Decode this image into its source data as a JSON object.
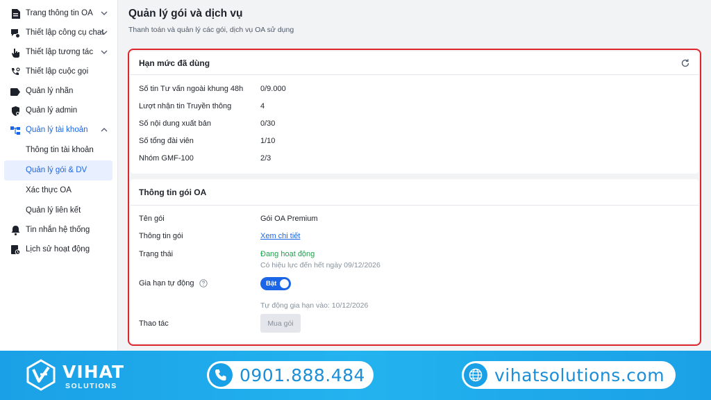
{
  "sidebar": {
    "items": [
      {
        "label": "Trang thông tin OA",
        "icon": "document-icon",
        "chevron": "down"
      },
      {
        "label": "Thiết lập công cụ chat",
        "icon": "chat-settings-icon",
        "chevron": "down"
      },
      {
        "label": "Thiết lập tương tác",
        "icon": "pointer-hand-icon",
        "chevron": "down"
      },
      {
        "label": "Thiết lập cuộc gọi",
        "icon": "phone-settings-icon"
      },
      {
        "label": "Quản lý nhãn",
        "icon": "tag-icon"
      },
      {
        "label": "Quản lý admin",
        "icon": "shield-user-icon"
      },
      {
        "label": "Quản lý tài khoản",
        "icon": "account-tree-icon",
        "chevron": "up"
      }
    ],
    "sub_items": [
      {
        "label": "Thông tin tài khoản"
      },
      {
        "label": "Quản lý gói & DV"
      },
      {
        "label": "Xác thực OA"
      },
      {
        "label": "Quản lý liên kết"
      }
    ],
    "bottom_items": [
      {
        "label": "Tin nhắn hệ thống",
        "icon": "bell-icon"
      },
      {
        "label": "Lịch sử hoạt động",
        "icon": "history-icon"
      }
    ]
  },
  "header": {
    "title": "Quản lý gói và dịch vụ",
    "subtitle": "Thanh toán và quản lý các gói, dịch vụ OA sử dụng"
  },
  "quota": {
    "title": "Hạn mức đã dùng",
    "rows": [
      {
        "label": "Số tin Tư vấn ngoài khung 48h",
        "value": "0/9.000"
      },
      {
        "label": "Lượt nhận tin Truyền thông",
        "value": "4"
      },
      {
        "label": "Số nội dung xuất bản",
        "value": "0/30"
      },
      {
        "label": "Số tổng đài viên",
        "value": "1/10"
      },
      {
        "label": "Nhóm GMF-100",
        "value": "2/3"
      }
    ]
  },
  "package": {
    "title": "Thông tin gói OA",
    "name_label": "Tên gói",
    "name_value": "Gói OA Premium",
    "info_label": "Thông tin gói",
    "info_link": "Xem chi tiết",
    "status_label": "Trạng thái",
    "status_value": "Đang hoạt động",
    "status_note": "Có hiệu lực đến hết ngày 09/12/2026",
    "renew_label": "Gia hạn tự động",
    "renew_toggle": "Bật",
    "renew_note": "Tự động gia hạn vào: 10/12/2026",
    "action_label": "Thao tác",
    "buy_button": "Mua gói"
  },
  "banner": {
    "brand": "VIHAT",
    "brand_sub": "SOLUTIONS",
    "phone": "0901.888.484",
    "website": "vihatsolutions.com"
  },
  "colors": {
    "accent": "#1a66e6",
    "highlight_border": "#e0242c",
    "status_active": "#1aa34a",
    "banner": "#1aa0e6"
  }
}
